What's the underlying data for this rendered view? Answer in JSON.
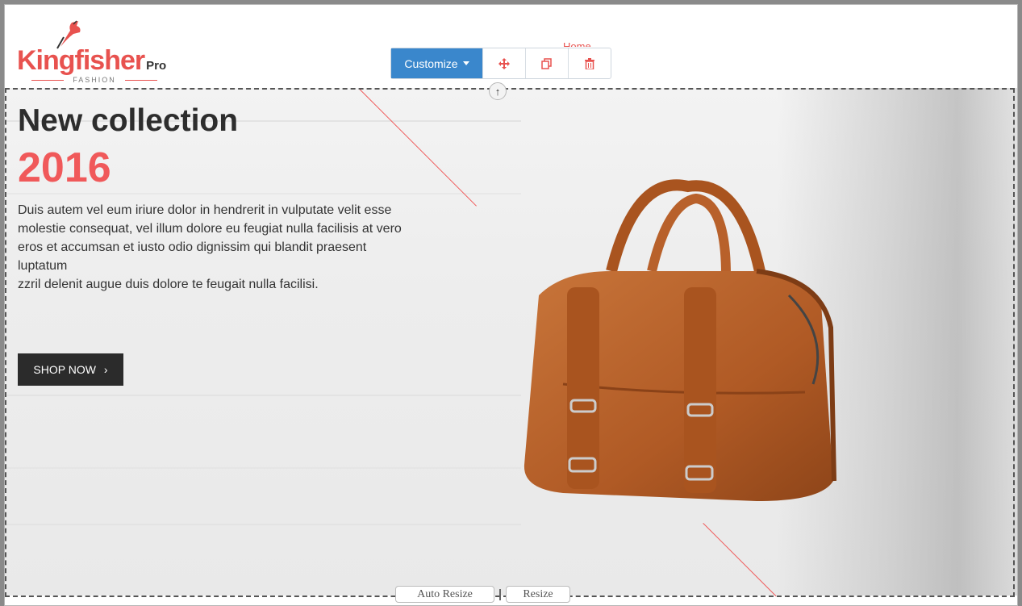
{
  "logo": {
    "word": "Kingfisher",
    "suffix": "Pro",
    "sub": "FASHION"
  },
  "nav": {
    "home": "Home"
  },
  "toolbar": {
    "customize": "Customize",
    "move_icon": "move-icon",
    "copy_icon": "copy-icon",
    "delete_icon": "trash-icon"
  },
  "hero": {
    "headline": "New collection",
    "year": "2016",
    "description_lines": [
      "Duis autem vel eum iriure dolor in hendrerit in vulputate velit esse",
      "molestie consequat, vel illum dolore eu feugiat nulla facilisis at vero",
      "eros et accumsan et iusto odio dignissim qui blandit praesent",
      "luptatum",
      "zzril delenit augue duis dolore te feugait nulla facilisi."
    ],
    "button": "SHOP NOW",
    "button_chevron": "›"
  },
  "resize": {
    "auto": "Auto Resize",
    "manual": "Resize"
  },
  "colors": {
    "accent": "#e8524f",
    "toolbar_blue": "#3a87cc",
    "button_dark": "#2b2b2b",
    "bag": "#b8612b"
  }
}
